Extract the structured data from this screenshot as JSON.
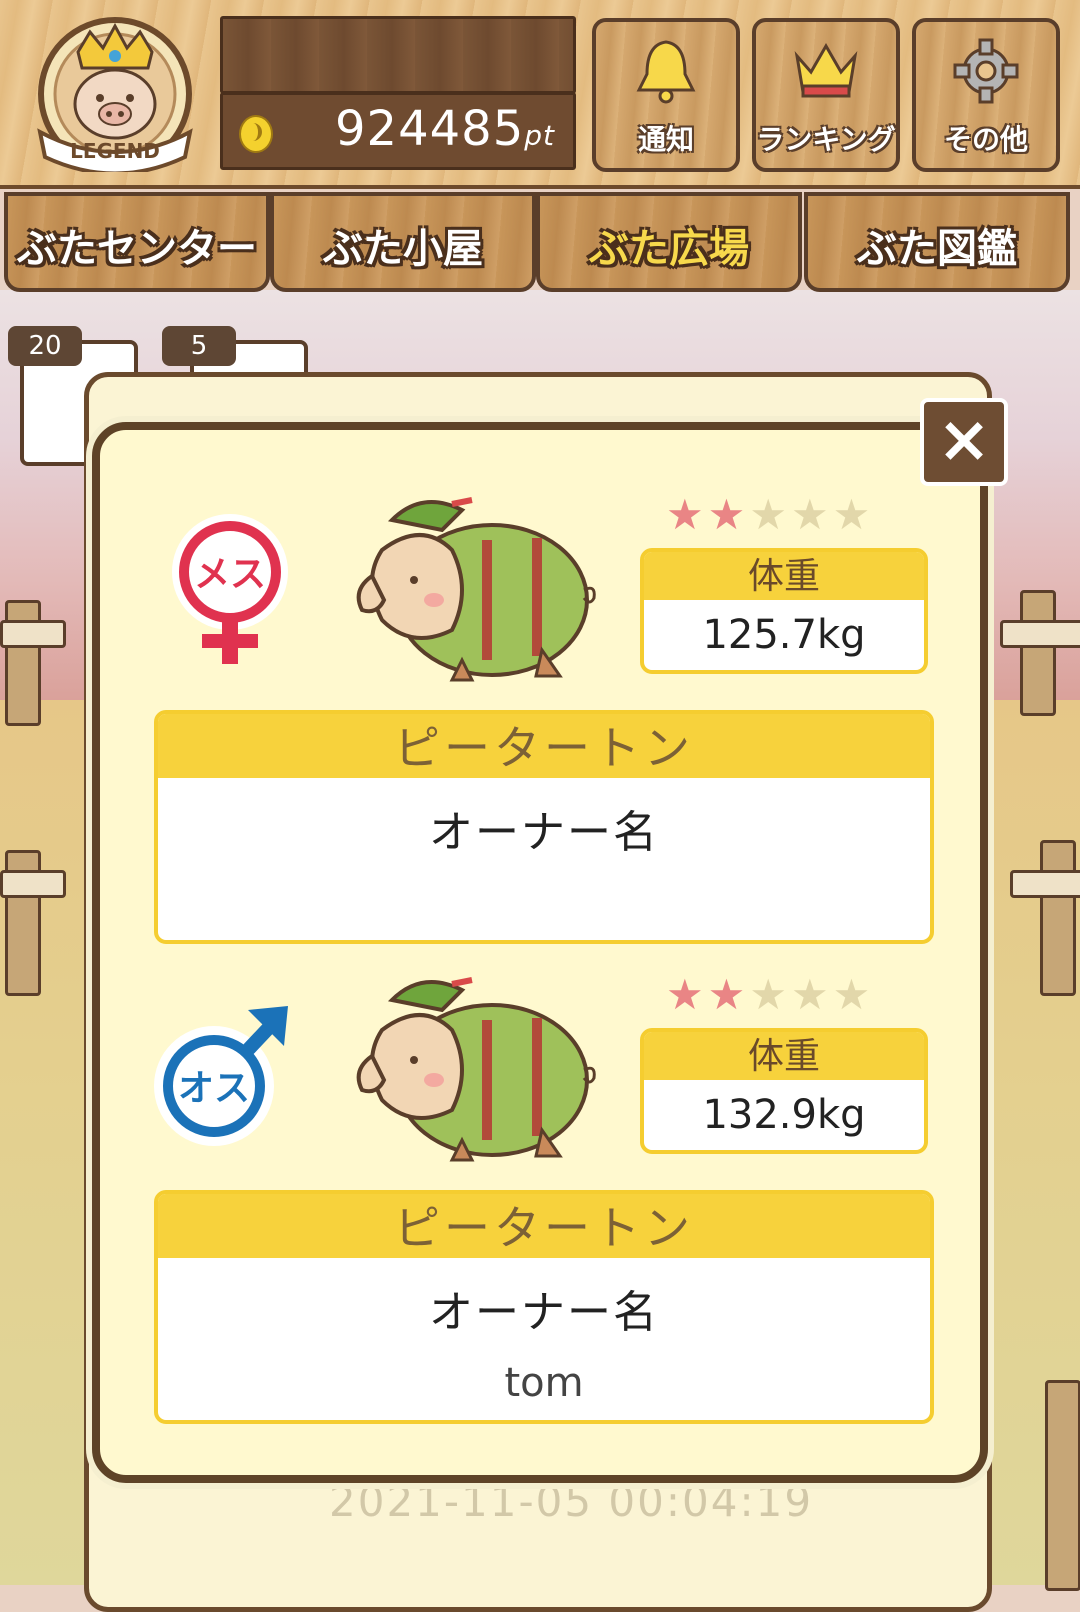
{
  "header": {
    "rank_badge_text": "LEGEND",
    "points_value": "924485",
    "points_unit": "pt",
    "buttons": [
      {
        "label": "通知",
        "icon": "bell-icon"
      },
      {
        "label": "ランキング",
        "icon": "crown-icon"
      },
      {
        "label": "その他",
        "icon": "gear-icon"
      }
    ]
  },
  "tabs": [
    {
      "label": "ぶたセンター",
      "active": false
    },
    {
      "label": "ぶた小屋",
      "active": false
    },
    {
      "label": "ぶた広場",
      "active": true
    },
    {
      "label": "ぶた図鑑",
      "active": false
    }
  ],
  "background": {
    "counters": [
      "20",
      "5"
    ],
    "timestamp": "2021-11-05 00:04:19"
  },
  "dialog": {
    "close_label": "×",
    "pigs": [
      {
        "gender_icon": "female-symbol-icon",
        "gender_label": "メス",
        "stars_on": 2,
        "stars_total": 5,
        "weight_label": "体重",
        "weight_value": "125.7kg",
        "breed_name": "ピータートン",
        "owner_label": "オーナー名",
        "owner_name": ""
      },
      {
        "gender_icon": "male-symbol-icon",
        "gender_label": "オス",
        "stars_on": 2,
        "stars_total": 5,
        "weight_label": "体重",
        "weight_value": "132.9kg",
        "breed_name": "ピータートン",
        "owner_label": "オーナー名",
        "owner_name": "tom"
      }
    ]
  }
}
